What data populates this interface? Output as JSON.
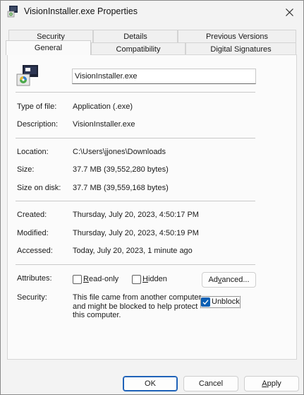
{
  "window": {
    "title": "VisionInstaller.exe Properties"
  },
  "tabs_back_row": [
    "Security",
    "Details",
    "Previous Versions"
  ],
  "tabs_front_row": [
    "General",
    "Compatibility",
    "Digital Signatures"
  ],
  "active_tab": "General",
  "general": {
    "file_name": "VisionInstaller.exe",
    "type_of_file_label": "Type of file:",
    "type_of_file": "Application (.exe)",
    "description_label": "Description:",
    "description": "VisionInstaller.exe",
    "location_label": "Location:",
    "location": "C:\\Users\\jjones\\Downloads",
    "size_label": "Size:",
    "size": "37.7 MB (39,552,280 bytes)",
    "size_on_disk_label": "Size on disk:",
    "size_on_disk": "37.7 MB (39,559,168 bytes)",
    "created_label": "Created:",
    "created": "Thursday, July 20, 2023, 4:50:17 PM",
    "modified_label": "Modified:",
    "modified": "Thursday, July 20, 2023, 4:50:19 PM",
    "accessed_label": "Accessed:",
    "accessed": "Today, July 20, 2023, 1 minute ago",
    "attributes_label": "Attributes:",
    "read_only_prefix": "",
    "read_only_accel": "R",
    "read_only_rest": "ead-only",
    "read_only_checked": false,
    "hidden_prefix": "",
    "hidden_accel": "H",
    "hidden_rest": "idden",
    "hidden_checked": false,
    "advanced_prefix": "Ad",
    "advanced_accel": "v",
    "advanced_rest": "anced...",
    "security_label": "Security:",
    "security_text": "This file came from another computer and might be blocked to help protect this computer.",
    "unblock_label": "Unblock",
    "unblock_checked": true
  },
  "footer": {
    "ok": "OK",
    "cancel": "Cancel",
    "apply_accel": "A",
    "apply_rest": "pply"
  },
  "colors": {
    "accent": "#0a5fb4",
    "window_bg": "#f3f3f3"
  }
}
